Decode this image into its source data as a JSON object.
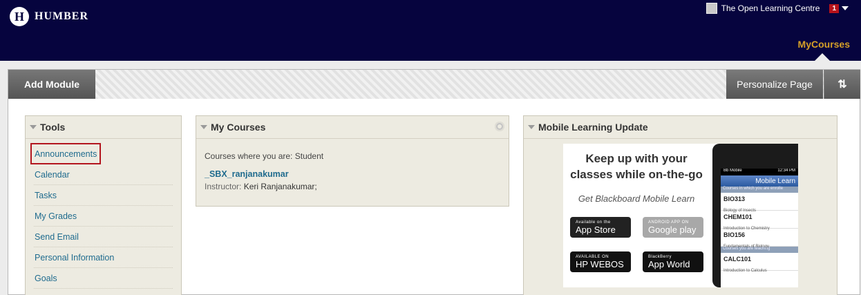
{
  "header": {
    "brand": "HUMBER",
    "user_name": "The Open Learning Centre",
    "notification_count": "1",
    "active_tab": "MyCourses",
    "brand_color": "#06043e",
    "accent_color": "#d6a028"
  },
  "actionbar": {
    "add_module_label": "Add Module",
    "personalize_label": "Personalize Page",
    "reorder_label": "⇅"
  },
  "tools": {
    "title": "Tools",
    "items": [
      "Announcements",
      "Calendar",
      "Tasks",
      "My Grades",
      "Send Email",
      "Personal Information",
      "Goals"
    ],
    "highlighted_item": "Announcements"
  },
  "my_courses": {
    "title": "My Courses",
    "role_text": "Courses where you are: Student",
    "course_name": "_SBX_ranjanakumar",
    "instructor_label": "Instructor:",
    "instructor_name": "Keri Ranjanakumar;"
  },
  "mobile": {
    "title": "Mobile Learning Update",
    "headline": "Keep up with your classes while on-the-go",
    "get_text": "Get Blackboard Mobile Learn",
    "stores": {
      "appstore_small": "Available on the",
      "appstore_big": "App Store",
      "google_small": "ANDROID APP ON",
      "google_big": "Google play",
      "hp_small": "AVAILABLE ON",
      "hp_big": "HP WEBOS",
      "bb_small": "BlackBerry",
      "bb_big": "App World"
    },
    "phone": {
      "carrier": "Bb Mobile",
      "time": "12:34 PM",
      "app_title": "Mobile Learn",
      "section_student": "Courses in which you are enrolle",
      "section_teaching": "Courses you are teaching",
      "courses": [
        {
          "code": "BIO313",
          "name": "Biology of Insects"
        },
        {
          "code": "CHEM101",
          "name": "Introduction to Chemistry"
        },
        {
          "code": "BIO156",
          "name": "Fundamentals of Biology"
        }
      ],
      "teaching": [
        {
          "code": "CALC101",
          "name": "Introduction to Calculus"
        }
      ]
    }
  }
}
